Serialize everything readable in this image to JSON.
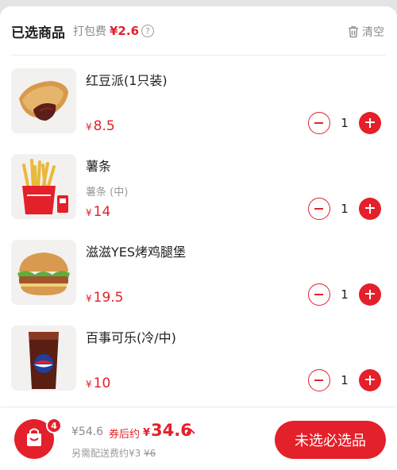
{
  "header": {
    "title": "已选商品",
    "packaging_label": "打包费",
    "packaging_price": "¥2.6",
    "help_glyph": "?",
    "clear_label": "清空"
  },
  "items": [
    {
      "name": "红豆派(1只装)",
      "spec": "",
      "currency": "¥",
      "price": "8.5",
      "qty": "1",
      "image": "red-bean-pie-image"
    },
    {
      "name": "薯条",
      "spec": "薯条 (中)",
      "currency": "¥",
      "price": "14",
      "qty": "1",
      "image": "fries-image"
    },
    {
      "name": "滋滋YES烤鸡腿堡",
      "spec": "",
      "currency": "¥",
      "price": "19.5",
      "qty": "1",
      "image": "chicken-burger-image"
    },
    {
      "name": "百事可乐(冷/中)",
      "spec": "",
      "currency": "¥",
      "price": "10",
      "qty": "1",
      "image": "pepsi-image"
    }
  ],
  "footer": {
    "cart_count": "4",
    "original_total": "¥54.6",
    "after_coupon_label": "券后约",
    "after_currency": "¥",
    "after_total": "34.6",
    "delivery_prefix": "另需配送费约¥3",
    "delivery_original": "¥6",
    "checkout_label": "未选必选品"
  },
  "colors": {
    "accent": "#e4202a",
    "muted": "#8a8a8a"
  }
}
